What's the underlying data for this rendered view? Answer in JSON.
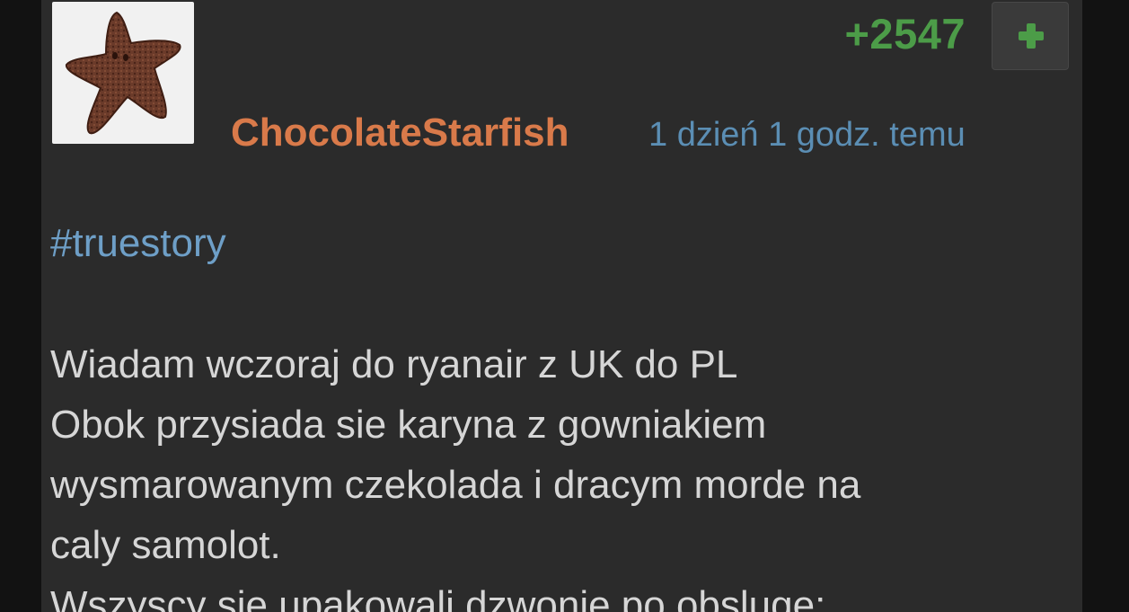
{
  "post": {
    "score": "+2547",
    "vote_icon": "plus-icon",
    "author": "ChocolateStarfish",
    "time": "1 dzień 1 godz. temu",
    "tag": "#truestory",
    "lines": [
      "Wiadam wczoraj do ryanair z UK do PL",
      "Obok przysiada sie karyna z gowniakiem",
      "wysmarowanym czekolada i dracym morde na",
      "caly samolot.",
      "Wszyscy sie upakowali dzwonie po obsluge:"
    ]
  },
  "colors": {
    "page_bg": "#121212",
    "panel_bg": "#2b2b2b",
    "score": "#4c9c48",
    "author": "#d97a4a",
    "time": "#5b8eb4",
    "tag": "#6e9fc7",
    "text": "#d6d6d6"
  }
}
